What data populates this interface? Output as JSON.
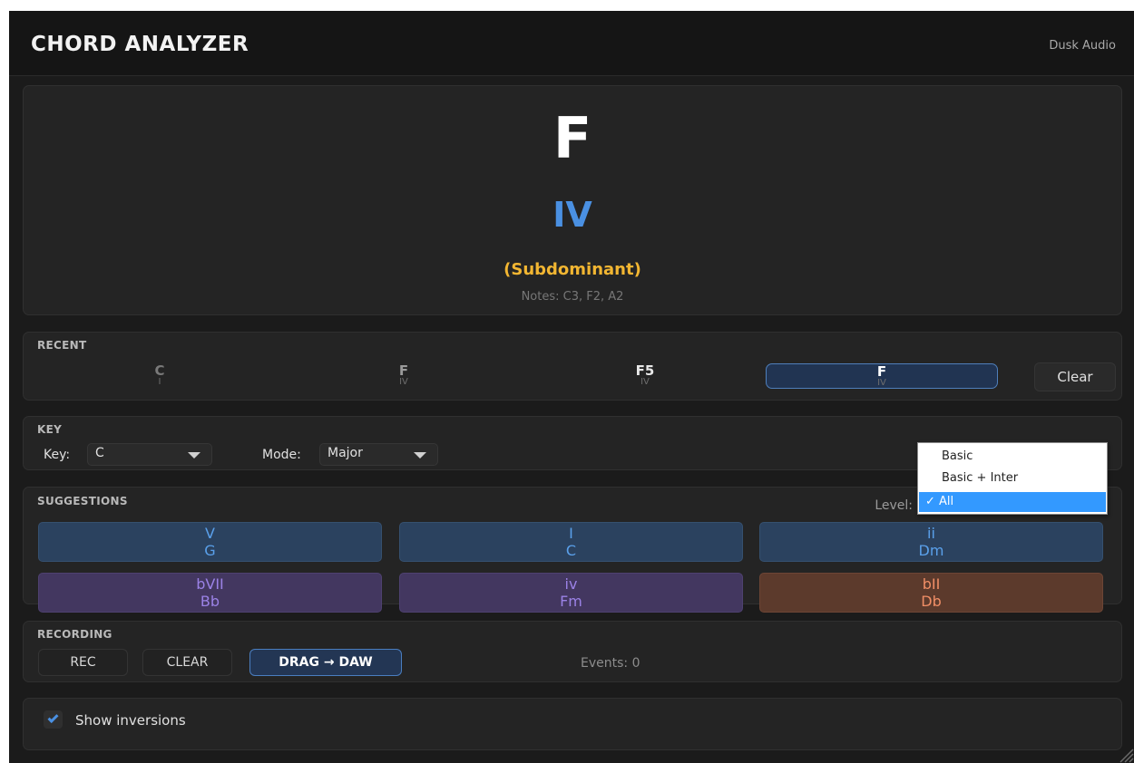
{
  "app": {
    "title": "CHORD ANALYZER",
    "brand": "Dusk Audio"
  },
  "current": {
    "chord": "F",
    "numeral": "IV",
    "function": "(Subdominant)",
    "notes": "Notes: C3, F2, A2"
  },
  "recent": {
    "label": "RECENT",
    "items": [
      {
        "symbol": "C",
        "numeral": "I",
        "color": "#7a7a7a"
      },
      {
        "symbol": "F",
        "numeral": "IV",
        "color": "#9a9a9a"
      },
      {
        "symbol": "F5",
        "numeral": "IV",
        "color": "#e8e8e8"
      },
      {
        "symbol": "F",
        "numeral": "IV",
        "color": "#ffffff",
        "active": true
      }
    ],
    "clear_label": "Clear"
  },
  "key": {
    "label": "KEY",
    "key_label": "Key:",
    "key_value": "C",
    "mode_label": "Mode:",
    "mode_value": "Major"
  },
  "suggestions": {
    "label": "SUGGESTIONS",
    "level_label": "Level:",
    "items": [
      {
        "numeral": "V",
        "chord": "G",
        "style": "blue"
      },
      {
        "numeral": "I",
        "chord": "C",
        "style": "blue"
      },
      {
        "numeral": "ii",
        "chord": "Dm",
        "style": "blue"
      },
      {
        "numeral": "bVII",
        "chord": "Bb",
        "style": "purple"
      },
      {
        "numeral": "iv",
        "chord": "Fm",
        "style": "purple"
      },
      {
        "numeral": "bII",
        "chord": "Db",
        "style": "orange"
      }
    ],
    "level_options": [
      {
        "label": "Basic",
        "selected": false
      },
      {
        "label": "Basic + Inter",
        "selected": false
      },
      {
        "label": "✓ All",
        "selected": true
      }
    ]
  },
  "recording": {
    "label": "RECORDING",
    "rec_label": "REC",
    "clear_label": "CLEAR",
    "drag_label": "DRAG → DAW",
    "events": "Events: 0"
  },
  "options": {
    "show_inversions_label": "Show inversions",
    "show_inversions_checked": true
  },
  "colors": {
    "accent": "#4a90e2",
    "function": "#f2b632",
    "suggest_blue": "#2b425f",
    "suggest_purple": "#433760",
    "suggest_orange": "#5c3a2c"
  }
}
